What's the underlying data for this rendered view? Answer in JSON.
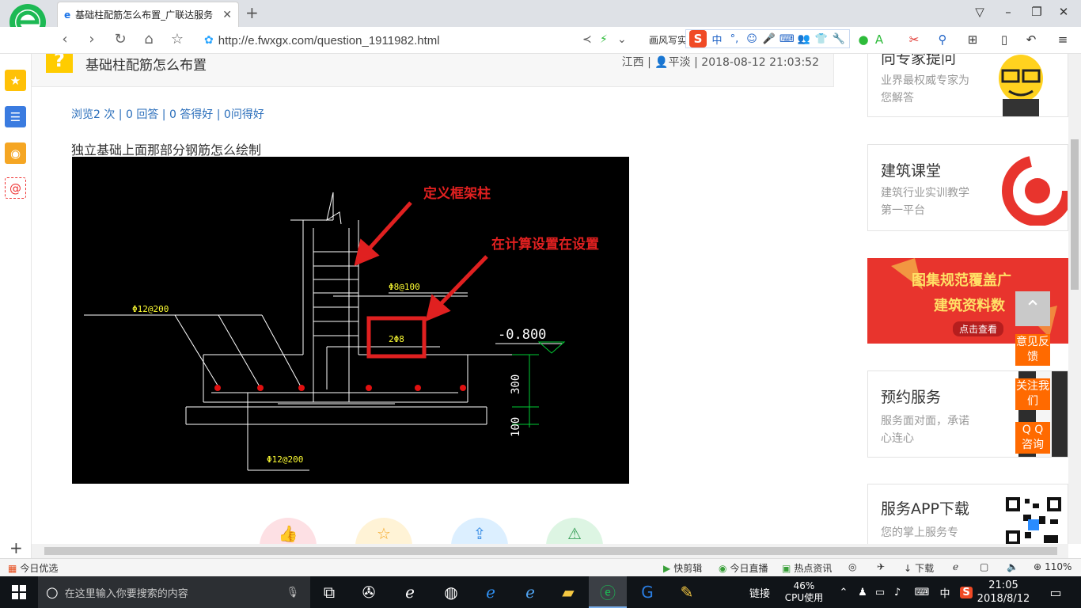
{
  "browser": {
    "tab_title": "基础柱配筋怎么布置_广联达服务",
    "url": "http://e.fwxgx.com/question_1911982.html",
    "search_engine": "画风写实",
    "ime": {
      "mode": "中",
      "punct": "°,"
    }
  },
  "question": {
    "badge": "?",
    "title": "基础柱配筋怎么布置",
    "meta_region": "江西",
    "meta_user": "平淡",
    "meta_time": "2018-08-12 21:03:52",
    "stats": "浏览2 次 | 0 回答 | 0 答得好 | 0问得好",
    "body": "独立基础上面那部分钢筋怎么绘制"
  },
  "diagram": {
    "annotation_1": "定义框架柱",
    "annotation_2": "在计算设置在设置",
    "label_stirrup": "Φ8@100",
    "label_top_bars": "Φ12@200",
    "label_box": "2Φ8",
    "label_elev": "-0.800",
    "label_300": "300",
    "label_100": "100",
    "label_bottom_bars": "Φ12@200",
    "colors": {
      "bg": "#000000",
      "lines": "#ffffff",
      "yellow": "#ffff33",
      "green": "#00cc33",
      "red": "#e02020",
      "rebar": "#e01010"
    }
  },
  "sidebar_right": {
    "expert": {
      "title": "向专家提问",
      "sub": "业界最权威专家为您解答"
    },
    "course": {
      "title": "建筑课堂",
      "sub": "建筑行业实训教学第一平台"
    },
    "banner": {
      "line1": "图集规范覆盖广",
      "line2": "建筑资料数",
      "cta": "点击查看"
    },
    "booking": {
      "title": "预约服务",
      "sub": "服务面对面，承诺心连心"
    },
    "app": {
      "title": "服务APP下载",
      "sub": "您的掌上服务专"
    }
  },
  "float_buttons": {
    "feedback": "意见反馈",
    "follow": "关注我们",
    "qq": "Q Q 咨询"
  },
  "statusbar": {
    "left": "今日优选",
    "items": [
      "快剪辑",
      "今日直播",
      "热点资讯"
    ],
    "download": "下载",
    "zoom": "110%"
  },
  "taskbar": {
    "search_placeholder": "在这里输入你要搜索的内容",
    "tray_link": "链接",
    "cpu_percent": "46%",
    "cpu_label": "CPU使用",
    "ime": "中",
    "time": "21:05",
    "date": "2018/8/12"
  }
}
